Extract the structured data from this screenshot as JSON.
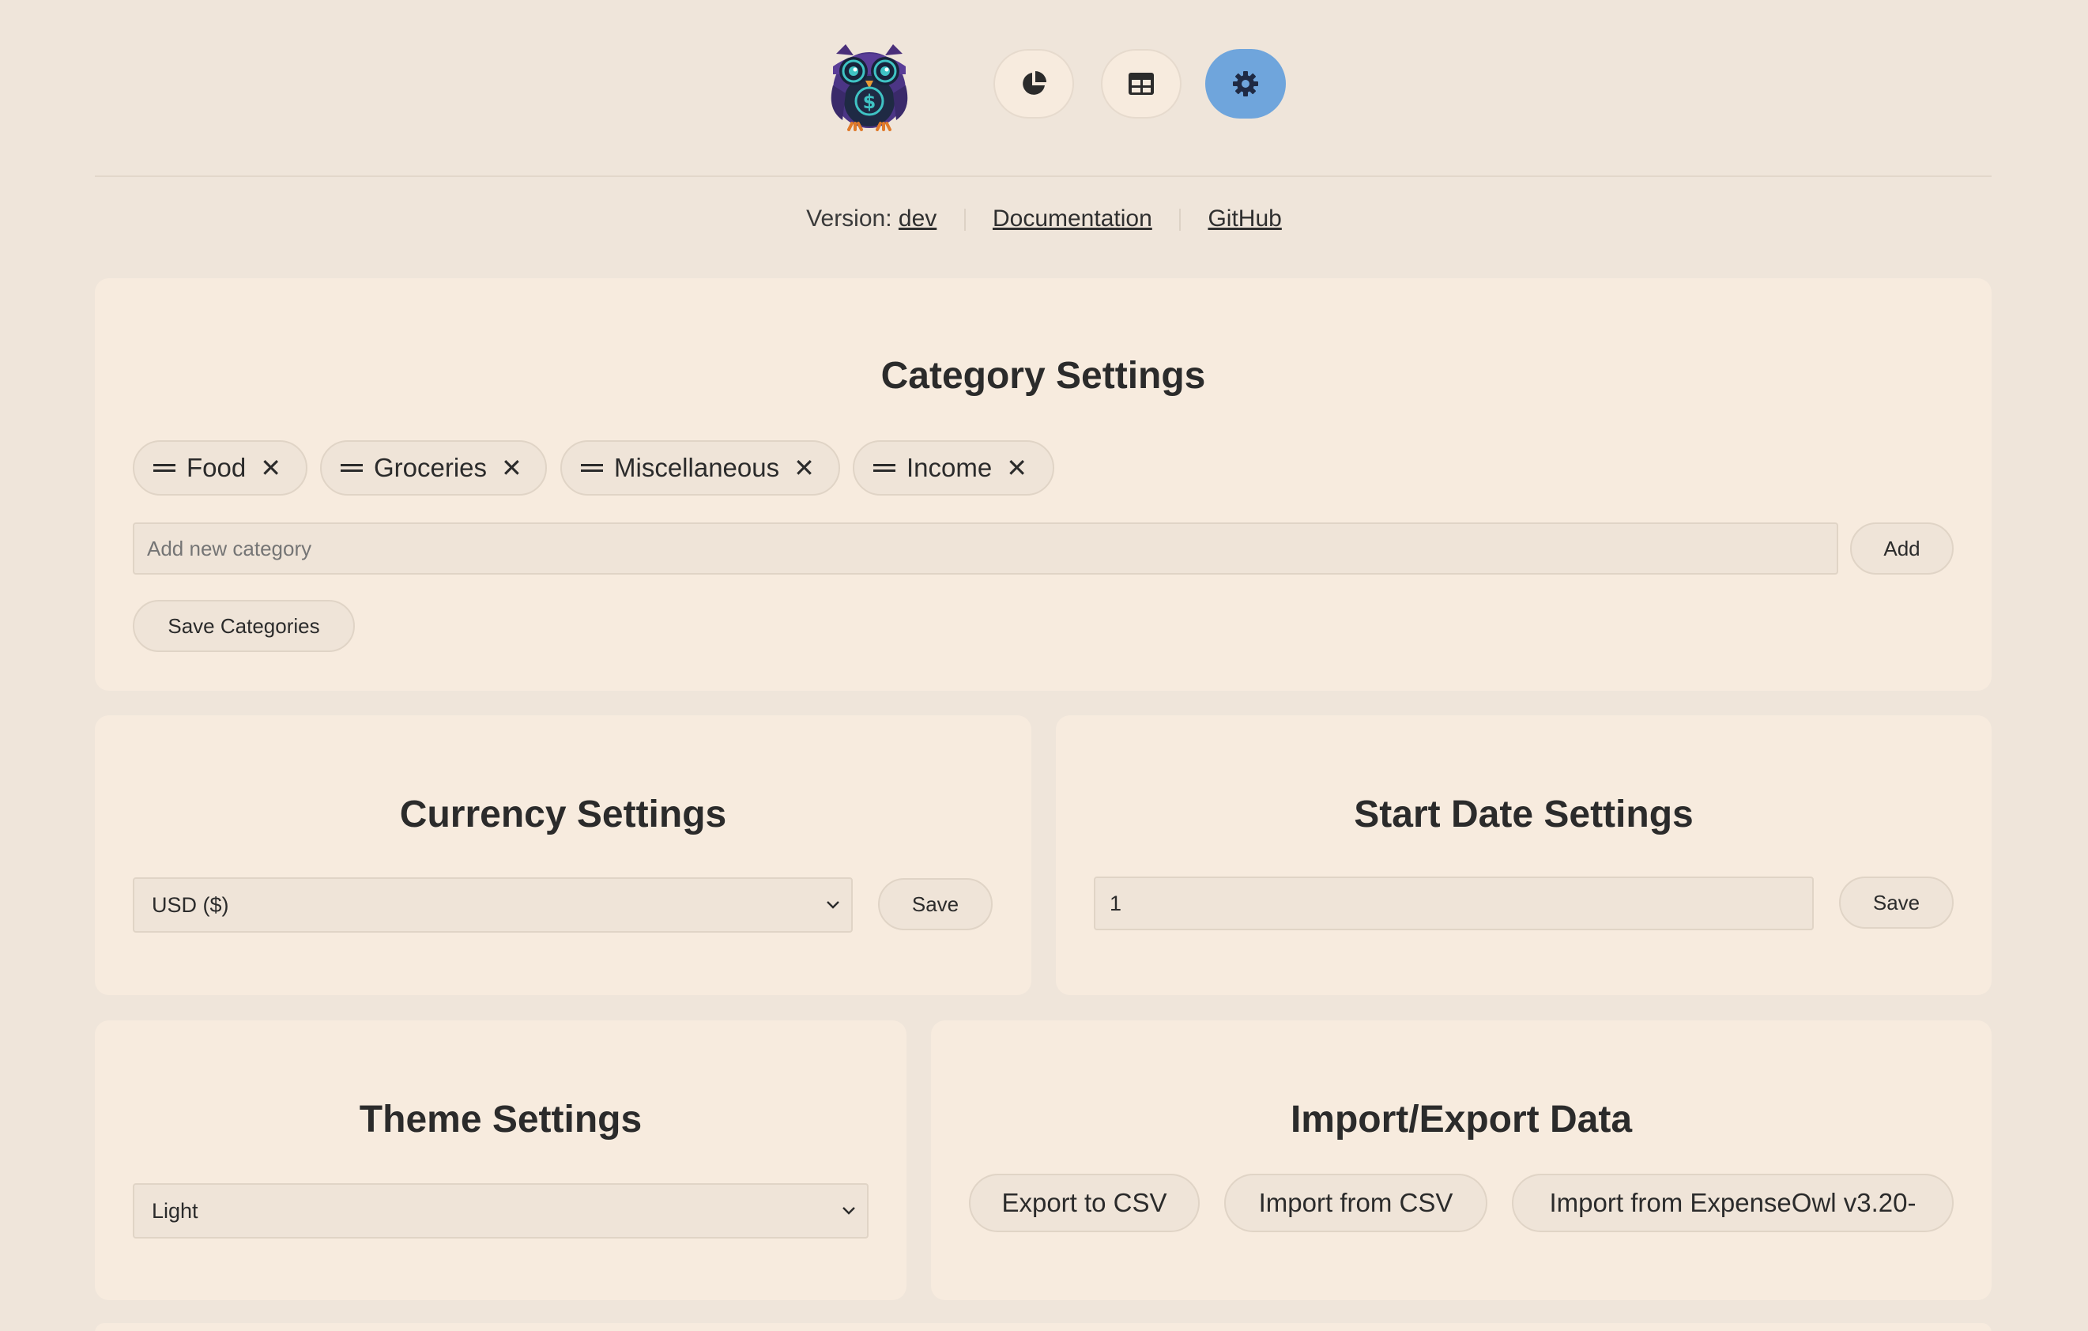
{
  "nav": {
    "logo_icon": "owl-dollar-logo",
    "buttons": [
      {
        "icon": "pie-chart-icon",
        "active": false
      },
      {
        "icon": "table-icon",
        "active": false
      },
      {
        "icon": "gear-icon",
        "active": true
      }
    ],
    "active_color": "#6fa5dc"
  },
  "meta": {
    "version_label": "Version:",
    "version_value": "dev",
    "documentation_link": "Documentation",
    "github_link": "GitHub"
  },
  "category_settings": {
    "title": "Category Settings",
    "categories": [
      "Food",
      "Groceries",
      "Miscellaneous",
      "Income"
    ],
    "new_category_placeholder": "Add new category",
    "add_label": "Add",
    "save_label": "Save Categories"
  },
  "currency_settings": {
    "title": "Currency Settings",
    "selected": "USD ($)",
    "save_label": "Save"
  },
  "start_date_settings": {
    "title": "Start Date Settings",
    "value": "1",
    "save_label": "Save"
  },
  "theme_settings": {
    "title": "Theme Settings",
    "selected": "Light"
  },
  "import_export": {
    "title": "Import/Export Data",
    "export_csv_label": "Export to CSV",
    "import_csv_label": "Import from CSV",
    "import_legacy_label": "Import from ExpenseOwl v3.20-"
  }
}
